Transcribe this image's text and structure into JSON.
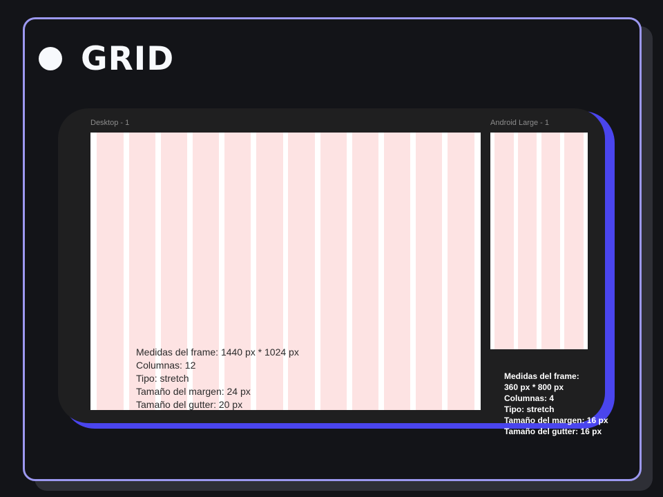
{
  "title": "GRID",
  "colors": {
    "background": "#131418",
    "slide_border": "#9c98f0",
    "canvas": "#1f1f20",
    "canvas_glow": "#4a45ee",
    "column": "#fde3e3",
    "frame": "#ffffff"
  },
  "desktop": {
    "label": "Desktop - 1",
    "columns": 12,
    "specs": [
      "Medidas del frame: 1440 px  * 1024 px",
      "Columnas: 12",
      "Tipo: stretch",
      "Tamaño del margen: 24 px",
      "Tamaño del gutter: 20 px"
    ]
  },
  "android": {
    "label": "Android Large - 1",
    "columns": 4,
    "specs": [
      "Medidas del frame:",
      "360 px * 800 px",
      "Columnas: 4",
      "Tipo: stretch",
      "Tamaño del margen: 16 px",
      "Tamaño del gutter: 16 px"
    ]
  }
}
